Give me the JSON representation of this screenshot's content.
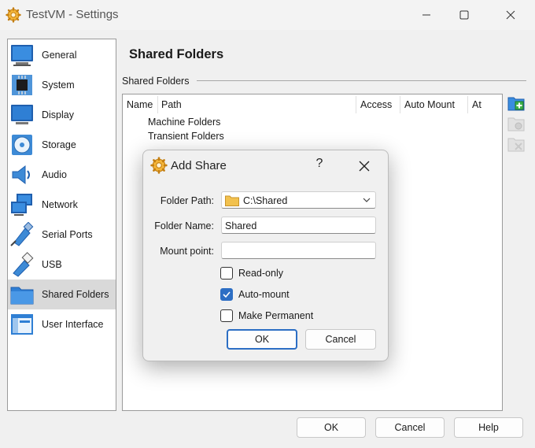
{
  "window": {
    "title": "TestVM - Settings"
  },
  "sidebar": {
    "items": [
      {
        "label": "General",
        "icon": "general-icon"
      },
      {
        "label": "System",
        "icon": "system-chip-icon"
      },
      {
        "label": "Display",
        "icon": "display-monitor-icon"
      },
      {
        "label": "Storage",
        "icon": "storage-disc-icon"
      },
      {
        "label": "Audio",
        "icon": "audio-speaker-icon"
      },
      {
        "label": "Network",
        "icon": "network-icon"
      },
      {
        "label": "Serial Ports",
        "icon": "serial-ports-icon"
      },
      {
        "label": "USB",
        "icon": "usb-icon"
      },
      {
        "label": "Shared Folders",
        "icon": "shared-folder-icon",
        "selected": true
      },
      {
        "label": "User Interface",
        "icon": "user-interface-icon"
      }
    ]
  },
  "main": {
    "title": "Shared Folders",
    "group_label": "Shared Folders",
    "table": {
      "columns": [
        "Name",
        "Path",
        "Access",
        "Auto Mount",
        "At"
      ],
      "rows": [
        "Machine Folders",
        "Transient Folders"
      ]
    },
    "tools": [
      "add-shared-folder-icon",
      "edit-shared-folder-icon",
      "remove-shared-folder-icon"
    ]
  },
  "buttons": {
    "ok": "OK",
    "cancel": "Cancel",
    "help": "Help"
  },
  "dialog": {
    "title": "Add Share",
    "help": "?",
    "folder_path_label": "Folder Path:",
    "folder_path_value": "C:\\Shared",
    "folder_name_label": "Folder Name:",
    "folder_name_value": "Shared",
    "mount_point_label": "Mount point:",
    "mount_point_value": "",
    "read_only_label": "Read-only",
    "read_only": false,
    "auto_mount_label": "Auto-mount",
    "auto_mount": true,
    "make_permanent_label": "Make Permanent",
    "make_permanent": false,
    "ok": "OK",
    "cancel": "Cancel"
  },
  "colors": {
    "accent": "#2c6ec4",
    "folder_yellow": "#f2c14e",
    "selection": "#d9d9d9"
  }
}
